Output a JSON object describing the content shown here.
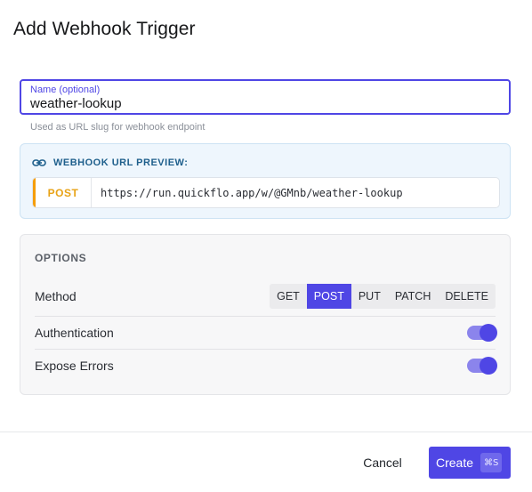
{
  "dialog": {
    "title": "Add Webhook Trigger"
  },
  "name_field": {
    "label": "Name (optional)",
    "value": "weather-lookup",
    "helper": "Used as URL slug for webhook endpoint"
  },
  "preview": {
    "icon": "link-icon",
    "title": "WEBHOOK URL PREVIEW:",
    "method": "POST",
    "url": "https://run.quickflo.app/w/@GMnb/weather-lookup",
    "method_color": "#e8a317"
  },
  "options": {
    "title": "OPTIONS",
    "method_label": "Method",
    "methods": [
      "GET",
      "POST",
      "PUT",
      "PATCH",
      "DELETE"
    ],
    "selected_method": "POST",
    "authentication_label": "Authentication",
    "authentication_enabled": true,
    "expose_errors_label": "Expose Errors",
    "expose_errors_enabled": true
  },
  "footer": {
    "cancel_label": "Cancel",
    "create_label": "Create",
    "create_shortcut": "⌘S"
  },
  "colors": {
    "accent": "#4f46e5",
    "preview_bg": "#eef6fd"
  }
}
